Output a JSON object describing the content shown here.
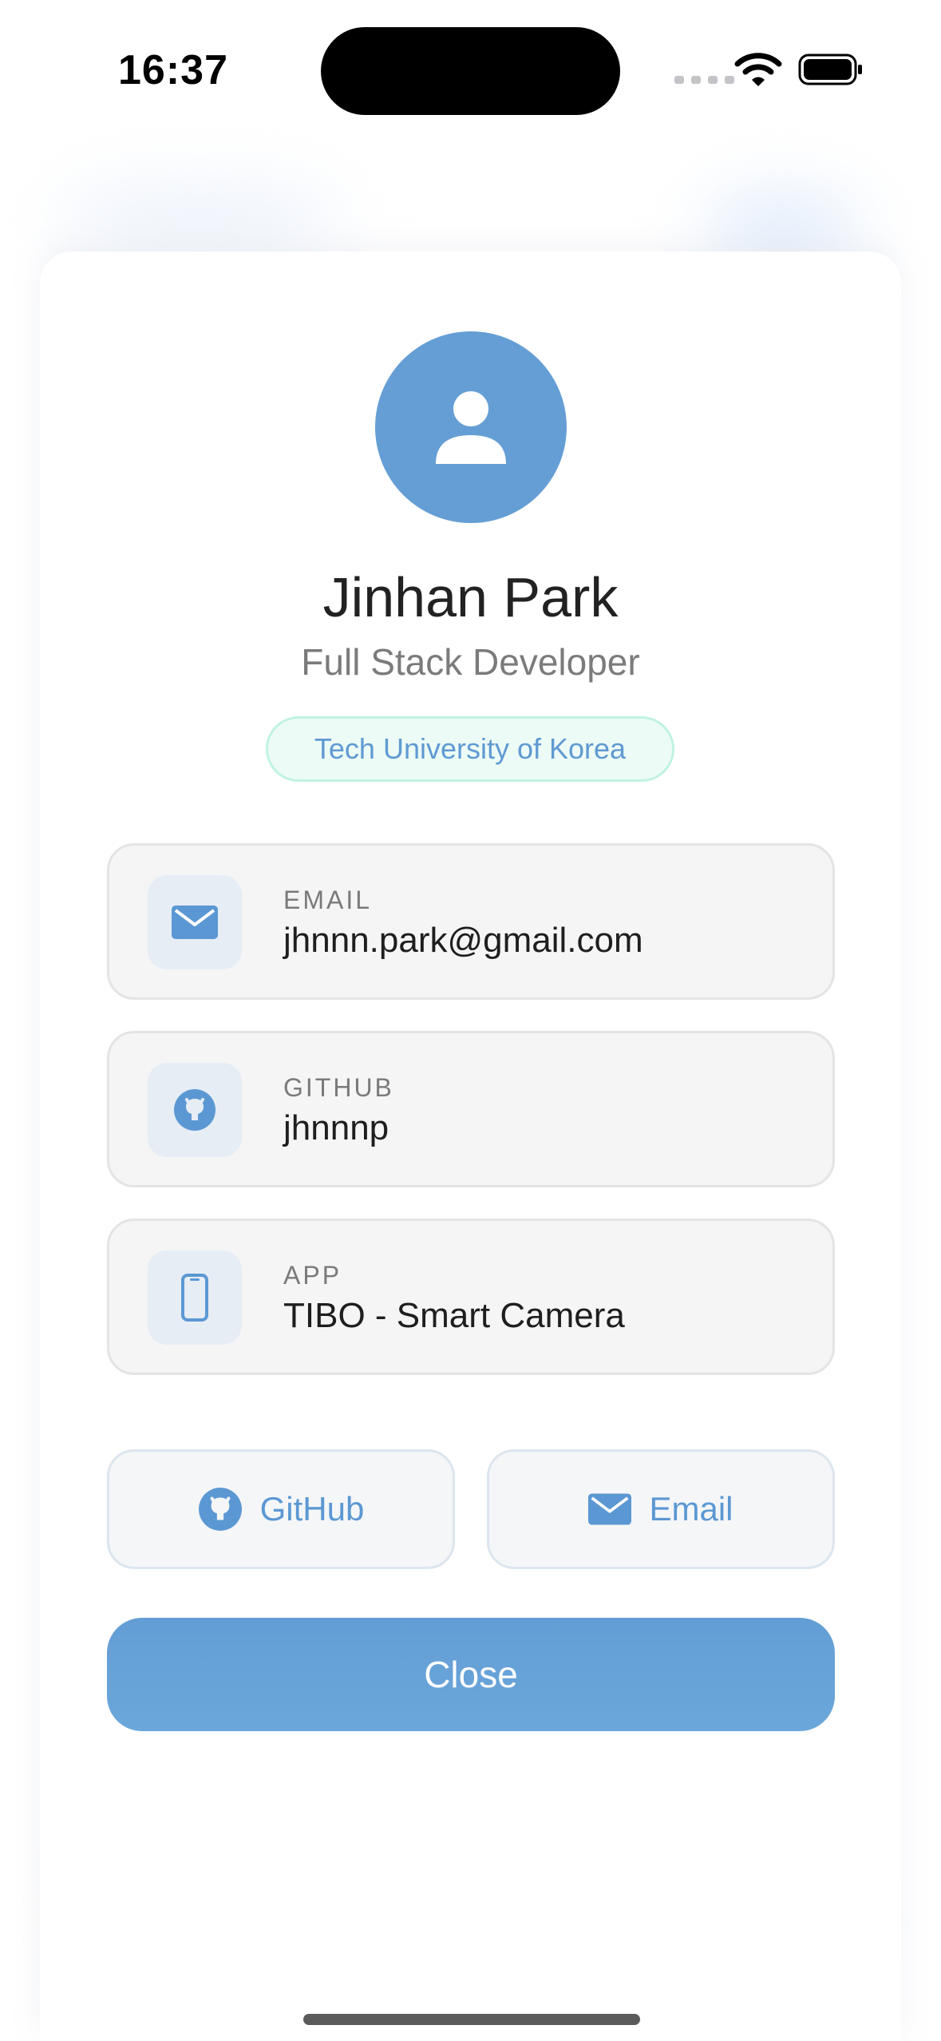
{
  "status_bar": {
    "time": "16:37"
  },
  "profile": {
    "name": "Jinhan Park",
    "role": "Full Stack Developer",
    "school": "Tech University of Korea"
  },
  "info_cards": [
    {
      "label": "EMAIL",
      "value": "jhnnn.park@gmail.com",
      "icon": "envelope-icon"
    },
    {
      "label": "GITHUB",
      "value": "jhnnnp",
      "icon": "github-icon"
    },
    {
      "label": "APP",
      "value": "TIBO - Smart Camera",
      "icon": "phone-icon"
    }
  ],
  "actions": {
    "github_label": "GitHub",
    "email_label": "Email"
  },
  "close_label": "Close",
  "colors": {
    "accent": "#659ed5",
    "badge_border": "#bff3df",
    "card_bg": "#f5f5f6"
  }
}
